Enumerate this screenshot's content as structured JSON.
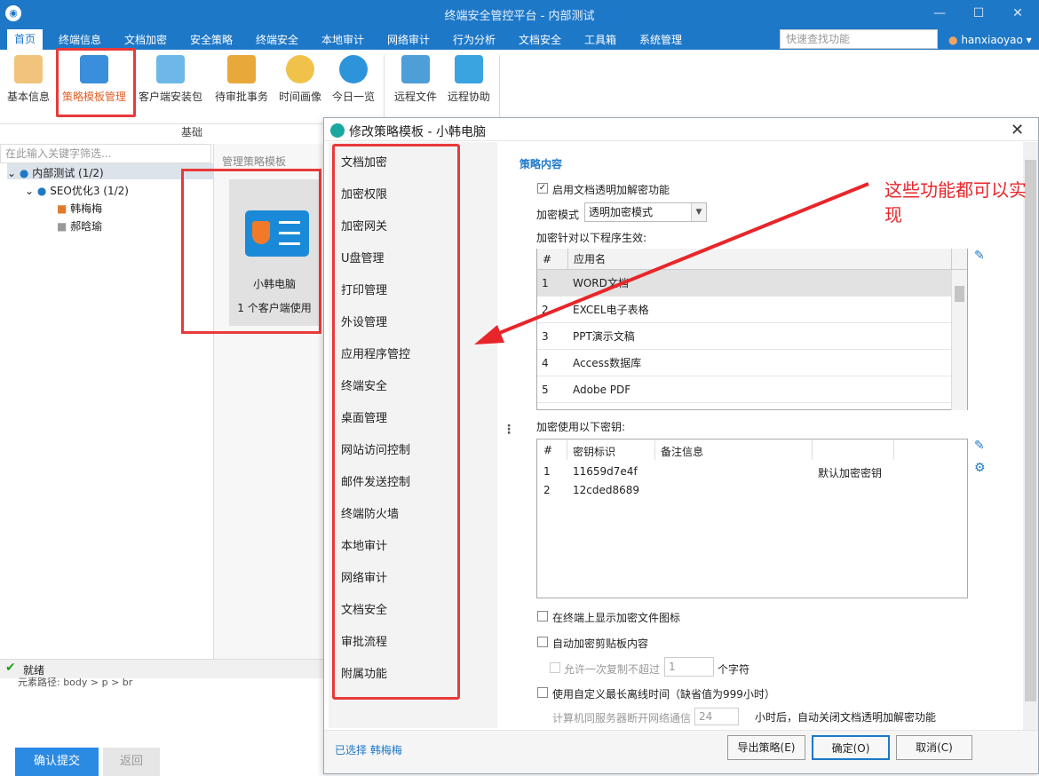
{
  "window": {
    "title": "终端安全管控平台 - 内部测试"
  },
  "menu": {
    "items": [
      "首页",
      "终端信息",
      "文档加密",
      "安全策略",
      "终端安全",
      "本地审计",
      "网络审计",
      "行为分析",
      "文档安全",
      "工具箱",
      "系统管理"
    ],
    "search_placeholder": "快速查找功能",
    "user": "hanxiaoyao"
  },
  "ribbon": {
    "buttons": [
      "基本信息",
      "策略模板管理",
      "客户端安装包",
      "待审批事务",
      "时间画像",
      "今日一览",
      "远程文件",
      "远程协助"
    ],
    "group_label": "基础"
  },
  "left": {
    "filter_placeholder": "在此输入关键字筛选...",
    "tree": {
      "root": "内部测试 (1/2)",
      "group": "SEO优化3 (1/2)",
      "users": [
        "韩梅梅",
        "郝晗瑜"
      ]
    },
    "mid_header": "管理策略模板",
    "card": {
      "name": "小韩电脑",
      "count": "1 个客户端使用"
    },
    "status": "就绪",
    "element_path": "元素路径: body > p > br",
    "confirm_button": "确认提交",
    "back_button": "返回"
  },
  "dialog": {
    "title": "修改策略模板 - 小韩电脑",
    "categories": [
      "文档加密",
      "加密权限",
      "加密网关",
      "U盘管理",
      "打印管理",
      "外设管理",
      "应用程序管控",
      "终端安全",
      "桌面管理",
      "网站访问控制",
      "邮件发送控制",
      "终端防火墙",
      "本地审计",
      "网络审计",
      "文档安全",
      "审批流程",
      "附属功能"
    ],
    "section_title": "策略内容",
    "enable_label": "启用文档透明加解密功能",
    "mode_label": "加密模式",
    "mode_value": "透明加密模式",
    "apps_label": "加密针对以下程序生效:",
    "apps_headers": [
      "#",
      "应用名"
    ],
    "apps": [
      {
        "n": "1",
        "name": "WORD文档"
      },
      {
        "n": "2",
        "name": "EXCEL电子表格"
      },
      {
        "n": "3",
        "name": "PPT演示文稿"
      },
      {
        "n": "4",
        "name": "Access数据库"
      },
      {
        "n": "5",
        "name": "Adobe PDF"
      }
    ],
    "keys_label": "加密使用以下密钥:",
    "keys_headers": [
      "#",
      "密钥标识",
      "备注信息"
    ],
    "keys": [
      {
        "n": "1",
        "id": "11659d7e4f",
        "note": "默认加密密钥"
      },
      {
        "n": "2",
        "id": "12cded8689",
        "note": ""
      }
    ],
    "opt_show_icon": "在终端上显示加密文件图标",
    "opt_clipboard": "自动加密剪贴板内容",
    "opt_copy_limit": "允许一次复制不超过",
    "opt_copy_value": "1",
    "opt_copy_unit": "个字符",
    "opt_offline": "使用自定义最长离线时间（缺省值为999小时）",
    "opt_disconnect": "计算机同服务器断开网络通信",
    "opt_disconnect_value": "24",
    "opt_disconnect_suffix": "小时后，自动关闭文档透明加解密功能",
    "selected_text": "已选择 韩梅梅",
    "buttons": {
      "export": "导出策略(E)",
      "ok": "确定(O)",
      "cancel": "取消(C)"
    }
  },
  "annotation": "这些功能都可以实现",
  "colors": {
    "accent": "#1e78c8",
    "highlight": "#e83a3a"
  }
}
